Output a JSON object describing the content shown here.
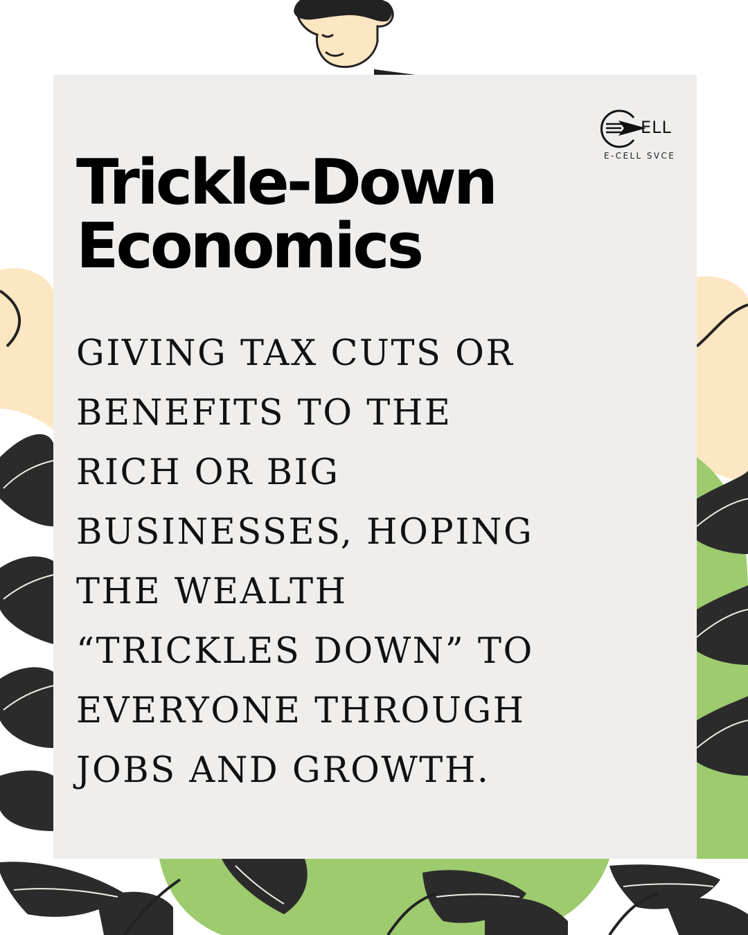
{
  "brand": {
    "wordmark": "ELL",
    "tagline": "E-CELL SVCE",
    "logo_icon": "paper-plane-in-circle-icon"
  },
  "title": {
    "line1": "Trickle-Down",
    "line2": "Economics"
  },
  "description": {
    "lines": [
      "GIVING TAX CUTS OR",
      "BENEFITS TO THE",
      "RICH OR BIG",
      "BUSINESSES, HOPING",
      "THE WEALTH",
      "“TRICKLES DOWN” TO",
      "EVERYONE THROUGH",
      "JOBS AND GROWTH."
    ]
  },
  "colors": {
    "card": "#efeeec",
    "leaf_dark": "#2b2b2b",
    "leaf_green": "#9dcb6e",
    "peach": "#fde6c2",
    "text": "#000000"
  }
}
